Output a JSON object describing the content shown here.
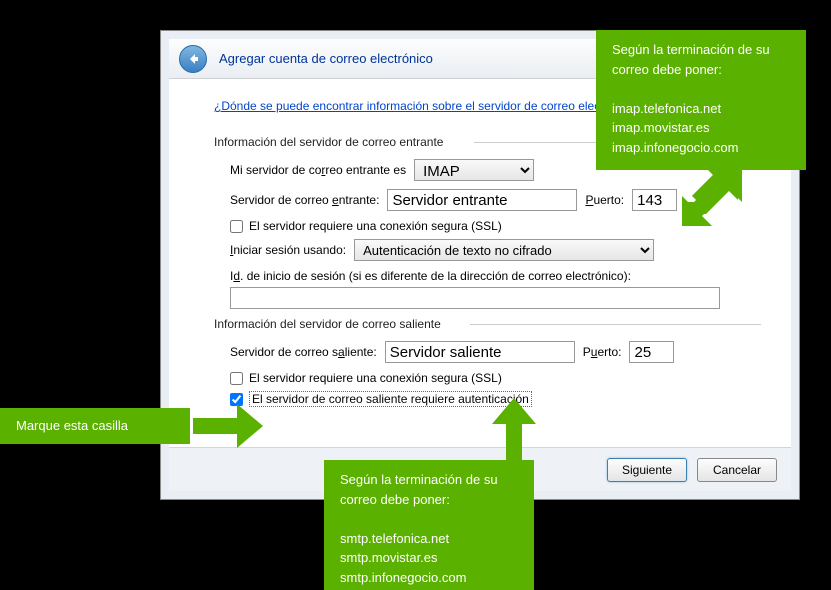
{
  "window": {
    "title": "Agregar cuenta de correo electrónico",
    "help_link": "¿Dónde se puede encontrar información sobre el servidor de correo electrónico?"
  },
  "incoming": {
    "group_label": "Información del servidor de correo entrante",
    "type_label_pre": "Mi servidor de co",
    "type_label_u": "r",
    "type_label_post": "reo entrante es",
    "type_value": "IMAP",
    "server_label_pre": "Servidor de correo ",
    "server_label_u": "e",
    "server_label_post": "ntrante:",
    "server_value": "Servidor entrante",
    "port_label_u": "P",
    "port_label_post": "uerto:",
    "port_value": "143",
    "ssl_label": "El servidor requiere una conexión segura (SSL)",
    "login_label_u": "I",
    "login_label_post": "niciar sesión usando:",
    "login_value": "Autenticación de texto no cifrado",
    "id_label_pre": "I",
    "id_label_u": "d",
    "id_label_post": ". de inicio de sesión (si es diferente de la dirección de correo electrónico):",
    "id_value": ""
  },
  "outgoing": {
    "group_label": "Información del servidor de correo saliente",
    "server_label_pre": "Servidor de correo s",
    "server_label_u": "a",
    "server_label_post": "liente:",
    "server_value": "Servidor saliente",
    "port_label_pre": "P",
    "port_label_u": "u",
    "port_label_post": "erto:",
    "port_value": "25",
    "ssl_label_pre": "El servidor requiere una conexión ",
    "ssl_label_hidden": "se",
    "ssl_label_post": "gura (SSL)",
    "auth_label_pre": "El servidor de correo saliente ",
    "auth_label_hidden": "requiere au",
    "auth_label_post": "tenticación"
  },
  "buttons": {
    "next": "Siguiente",
    "cancel": "Cancelar"
  },
  "callouts": {
    "topright_line1": "Según la terminación de su correo debe poner:",
    "topright_line2": "imap.telefonica.net",
    "topright_line3": "imap.movistar.es",
    "topright_line4": "imap.infonegocio.com",
    "left": "Marque esta casilla",
    "bottom_line1": "Según la terminación de su correo debe poner:",
    "bottom_line2": "smtp.telefonica.net",
    "bottom_line3": "smtp.movistar.es",
    "bottom_line4": "smtp.infonegocio.com"
  }
}
